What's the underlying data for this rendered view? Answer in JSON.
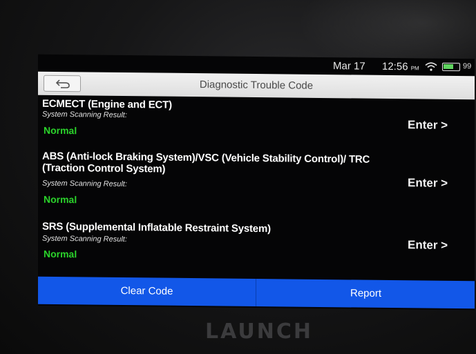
{
  "status": {
    "date": "Mar 17",
    "time": "12:56",
    "ampm": "PM",
    "battery_pct": "99"
  },
  "header": {
    "title": "Diagnostic Trouble Code",
    "back_icon": "back-arrow-icon"
  },
  "systems": [
    {
      "name": "ECMECT (Engine and ECT)",
      "result_label": "System Scanning Result:",
      "status": "Normal",
      "enter_label": "Enter >"
    },
    {
      "name": "ABS (Anti-lock Braking System)/VSC (Vehicle Stability Control)/ TRC (Traction Control System)",
      "result_label": "System Scanning Result:",
      "status": "Normal",
      "enter_label": "Enter >"
    },
    {
      "name": "SRS (Supplemental Inflatable Restraint System)",
      "result_label": "System Scanning Result:",
      "status": "Normal",
      "enter_label": "Enter >"
    }
  ],
  "footer": {
    "clear_label": "Clear Code",
    "report_label": "Report"
  },
  "device": {
    "brand": "LAUNCH"
  },
  "colors": {
    "accent": "#1257e8",
    "status_ok": "#2bd32b",
    "screen_bg": "#050506"
  }
}
